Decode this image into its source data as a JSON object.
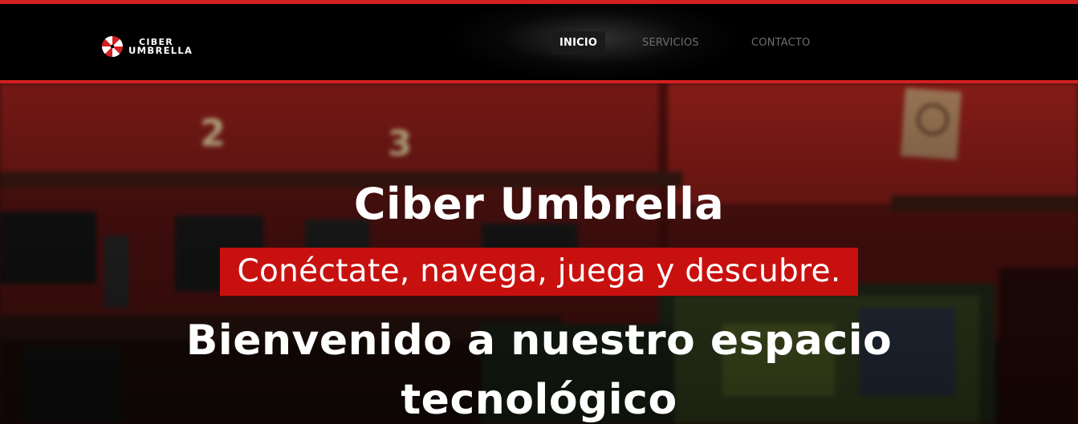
{
  "header": {
    "logo": {
      "line1": "CIBER",
      "line2": "UMBRELLA",
      "icon": "umbrella-logo-icon"
    },
    "nav": [
      {
        "label": "INICIO",
        "active": true
      },
      {
        "label": "SERVICIOS",
        "active": false
      },
      {
        "label": "CONTACTO",
        "active": false
      }
    ]
  },
  "hero": {
    "title": "Ciber Umbrella",
    "tagline": "Conéctate, navega, juega y descubre.",
    "welcome_line1": "Bienvenido a nuestro espacio",
    "welcome_line2": "tecnológico",
    "background_numbers": [
      "2",
      "3"
    ]
  },
  "colors": {
    "accent": "#d32020",
    "tagline_bg": "#c8110f",
    "background": "#000000"
  }
}
